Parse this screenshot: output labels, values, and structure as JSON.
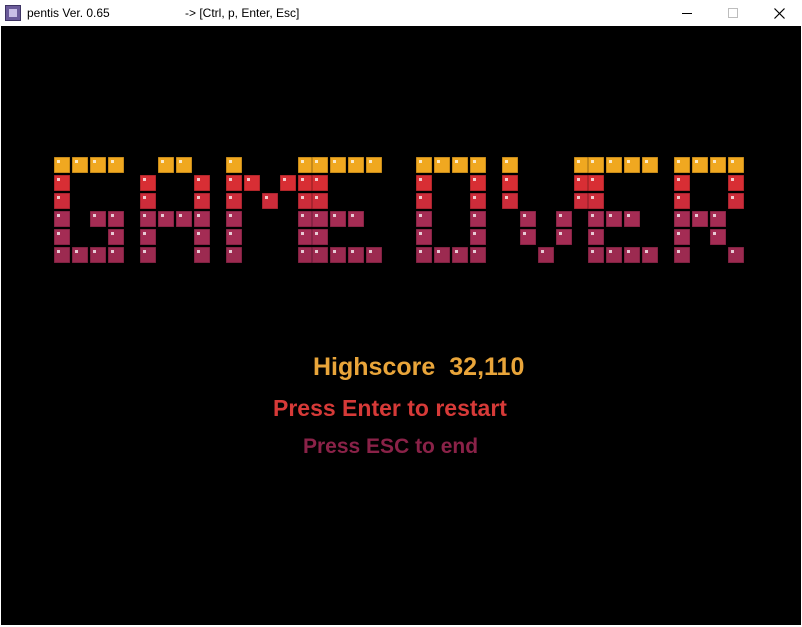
{
  "window": {
    "title": "pentis Ver. 0.65",
    "hint": "-> [Ctrl, p, Enter, Esc]",
    "buttons": {
      "minimize": "minimize-icon",
      "maximize": "maximize-icon",
      "close": "close-icon"
    }
  },
  "game": {
    "banner": "GAME OVER",
    "highscore_label": "Highscore",
    "highscore_value": "32,110",
    "restart_prompt": "Press Enter to restart",
    "end_prompt": "Press ESC to end",
    "colors": {
      "background": "#000000",
      "block_row_gradient": [
        "#f0a820",
        "#d82e34",
        "#cc2c3a",
        "#a52c54",
        "#a42c54",
        "#9c2a50"
      ],
      "highscore": "#e9a53a",
      "restart": "#d63a38",
      "end": "#8a2248"
    }
  }
}
